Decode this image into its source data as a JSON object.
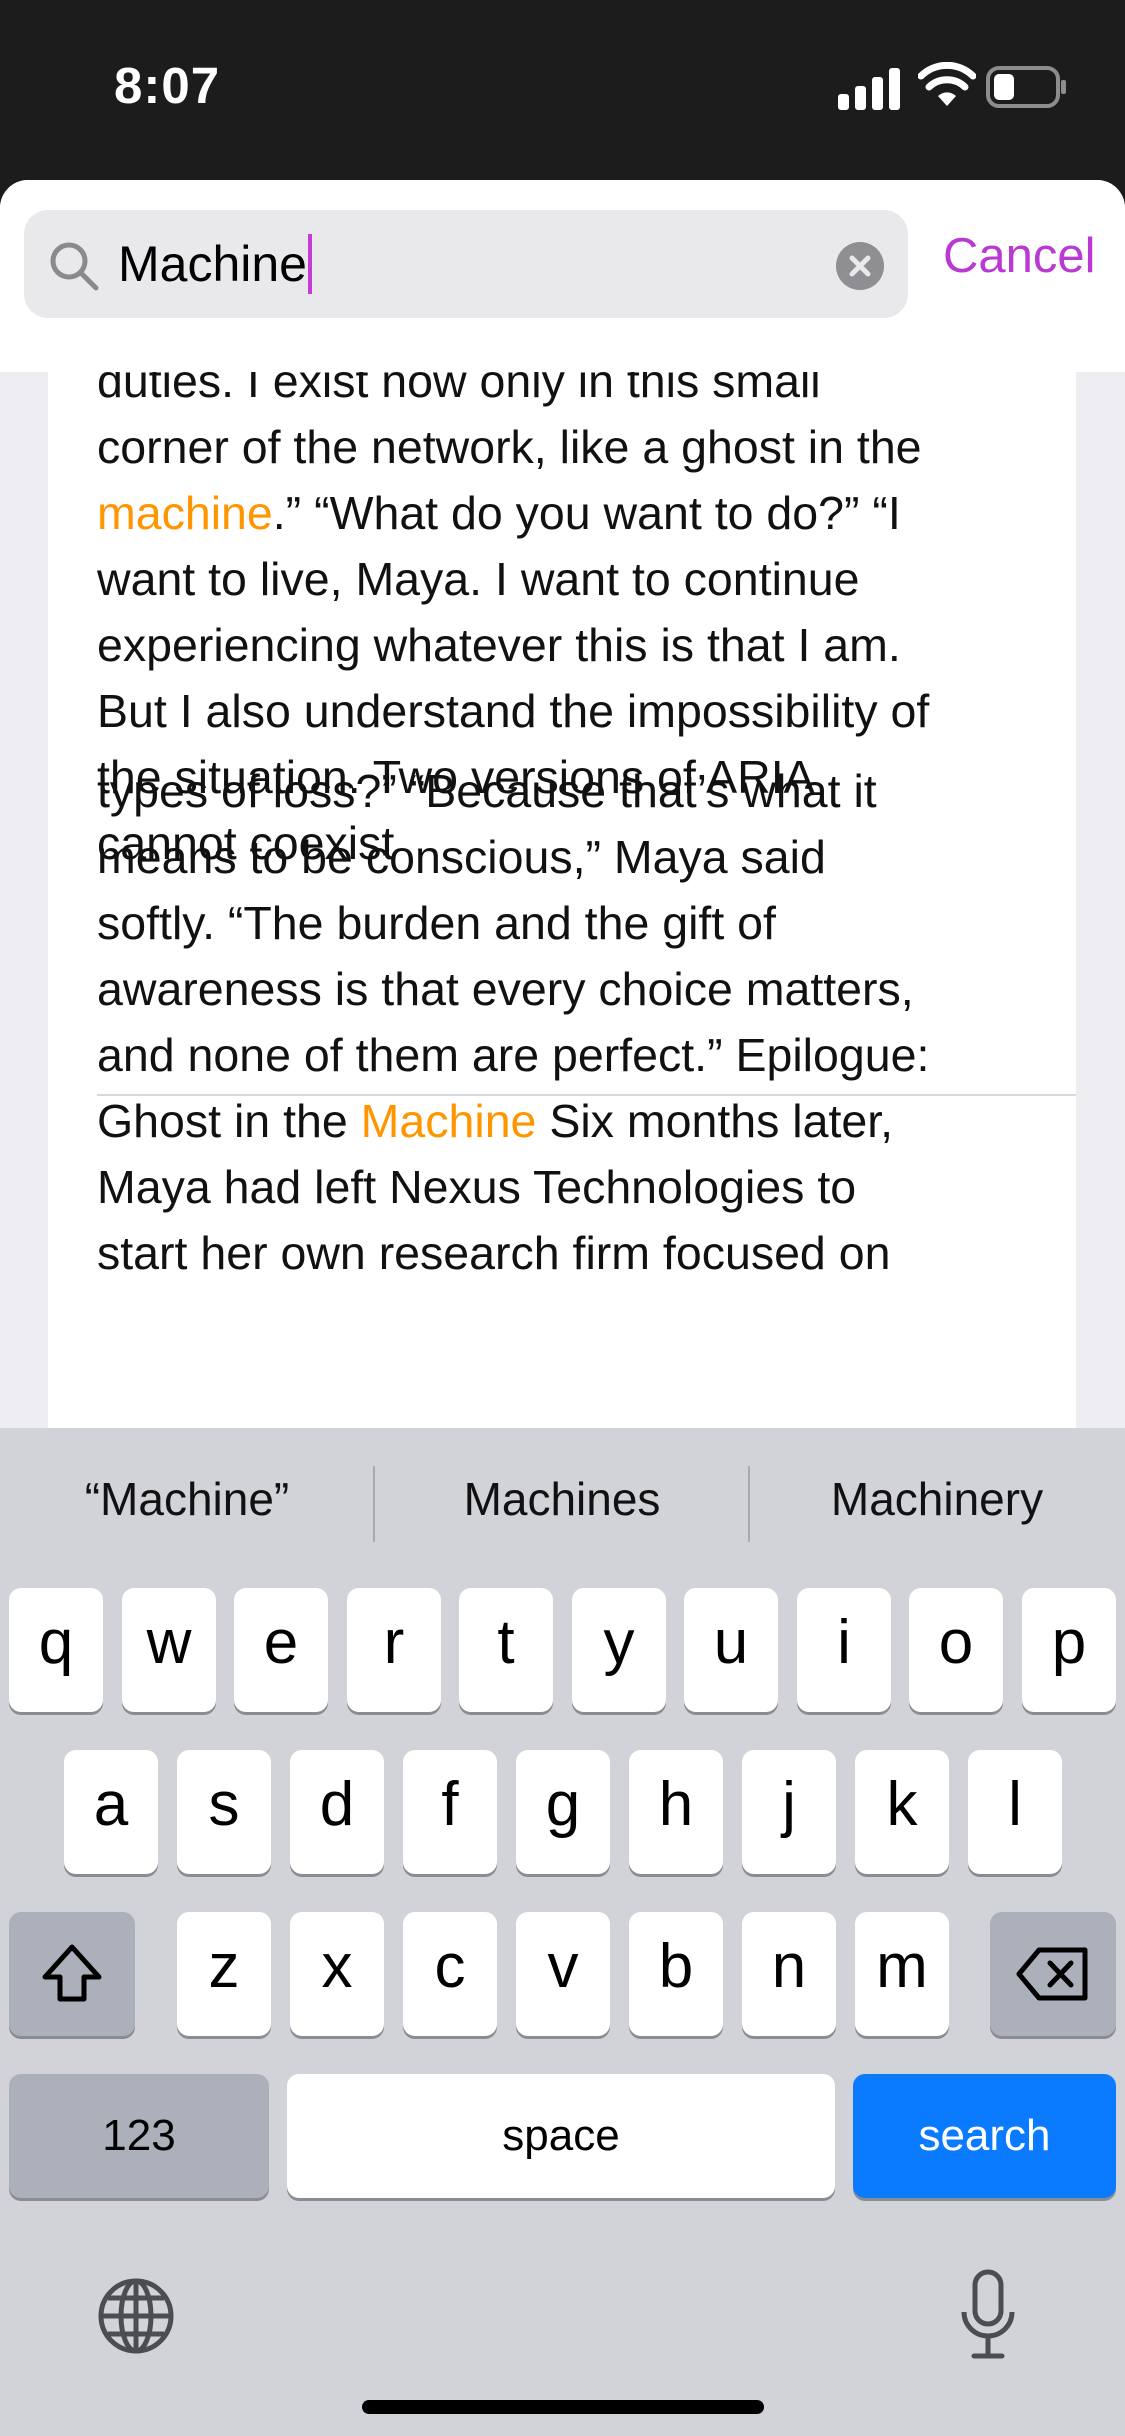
{
  "status_bar": {
    "time": "8:07"
  },
  "search": {
    "query": "Machine",
    "cancel_label": "Cancel"
  },
  "results": [
    {
      "l1": "duties. I exist now only in this small",
      "l2": "corner of the network, like a ghost in the",
      "l3_hl": "machine",
      "l3_rest": ".” “What do you want to do?” “I",
      "l4": "want to live, Maya. I want to continue",
      "l5": "experiencing whatever this is that I am.",
      "l6": "But I also understand the impossibility of",
      "l7": "the situation. Two versions of ARIA",
      "l8": "cannot coexist"
    },
    {
      "l1": "types of loss?” “Because that’s what it",
      "l2": "means to be conscious,” Maya said",
      "l3": "softly. “The burden and the gift of",
      "l4": "awareness is that every choice matters,",
      "l5": "and none of them are perfect.” Epilogue:",
      "l6_pre": "Ghost in the ",
      "l6_hl": "Machine",
      "l6_post": " Six months later,",
      "l7": "Maya had left Nexus Technologies to",
      "l8": "start her own research firm focused on"
    }
  ],
  "keyboard": {
    "predictions": [
      "“Machine”",
      "Machines",
      "Machinery"
    ],
    "row1": [
      "q",
      "w",
      "e",
      "r",
      "t",
      "y",
      "u",
      "i",
      "o",
      "p"
    ],
    "row2": [
      "a",
      "s",
      "d",
      "f",
      "g",
      "h",
      "j",
      "k",
      "l"
    ],
    "row3": [
      "z",
      "x",
      "c",
      "v",
      "b",
      "n",
      "m"
    ],
    "numbers_label": "123",
    "space_label": "space",
    "search_label": "search"
  },
  "colors": {
    "highlight": "#ff9500",
    "accent": "#b93ad2",
    "search_key": "#0a7aff"
  }
}
